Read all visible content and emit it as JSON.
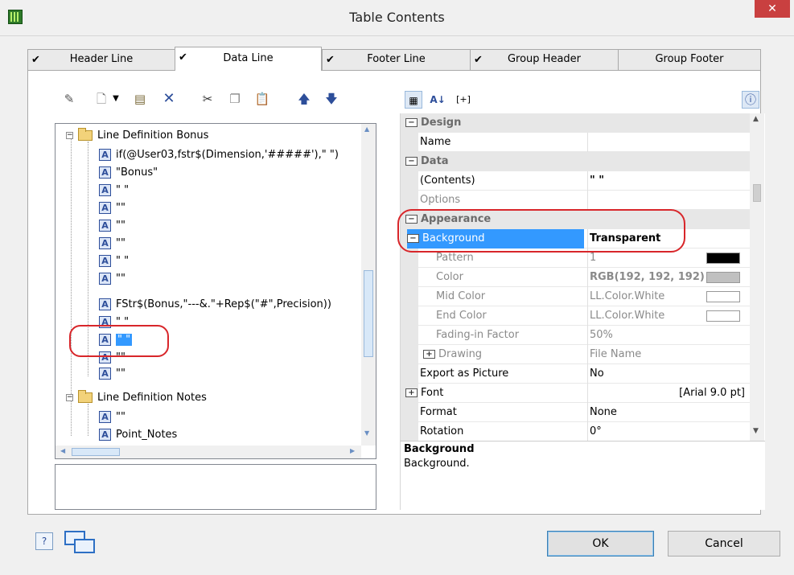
{
  "window": {
    "title": "Table Contents",
    "close": "✕"
  },
  "tabs": [
    {
      "label": "Header Line",
      "check": "✔"
    },
    {
      "label": "Data Line",
      "check": "✔"
    },
    {
      "label": "Footer Line",
      "check": "✔"
    },
    {
      "label": "Group Header",
      "check": "✔"
    },
    {
      "label": "Group Footer",
      "check": ""
    }
  ],
  "tree": {
    "folder1": "Line Definition Bonus",
    "items1": [
      "if(@User03,fstr$(Dimension,'#####'),\" \")",
      "\"Bonus\"",
      "\" \"",
      "\"\"",
      "\"\"",
      "\"\"",
      "\" \"",
      "\"\"",
      "FStr$(Bonus,\"---&.\"+Rep$(\"#\",Precision))",
      "\" \"",
      "\" \"",
      "\"\"",
      "\"\""
    ],
    "folder2": "Line Definition Notes",
    "items2": [
      "\"\"",
      "Point_Notes"
    ],
    "badge": "A"
  },
  "properties": {
    "design_cat": "Design",
    "name_label": "Name",
    "name_value": "",
    "data_cat": "Data",
    "contents_label": "(Contents)",
    "contents_value": "\" \"",
    "options_label": "Options",
    "options_value": "",
    "appearance_cat": "Appearance",
    "background_label": "Background",
    "background_value": "Transparent",
    "pattern_label": "Pattern",
    "pattern_value": "1",
    "color_label": "Color",
    "color_value": "RGB(192, 192, 192)",
    "midcolor_label": "Mid Color",
    "midcolor_value": "LL.Color.White",
    "endcolor_label": "End Color",
    "endcolor_value": "LL.Color.White",
    "fading_label": "Fading-in Factor",
    "fading_value": "50%",
    "drawing_label": "Drawing",
    "drawing_value": "File Name",
    "export_label": "Export as Picture",
    "export_value": "No",
    "font_label": "Font",
    "font_value": "[Arial 9.0 pt]",
    "format_label": "Format",
    "format_value": "None",
    "rotation_label": "Rotation",
    "rotation_value": "0°"
  },
  "help": {
    "title": "Background",
    "text": "Background."
  },
  "buttons": {
    "ok": "OK",
    "cancel": "Cancel"
  },
  "colors": {
    "selection": "#3399ff",
    "highlight_oval": "#d8262a",
    "close_button": "#c94040",
    "swatch_black": "#000000",
    "swatch_gray": "#c0c0c0",
    "swatch_white": "#ffffff"
  }
}
